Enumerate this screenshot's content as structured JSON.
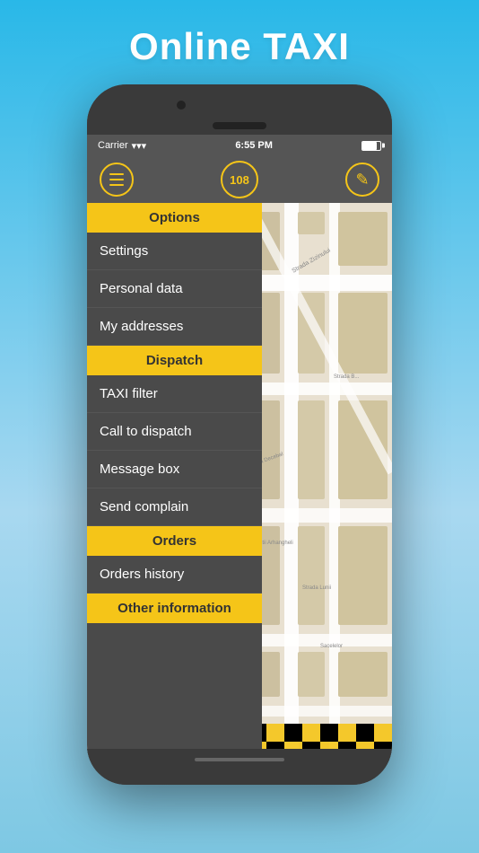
{
  "page": {
    "title": "Online TAXI",
    "background_color_top": "#29b8e8",
    "background_color_bottom": "#7ec8e3"
  },
  "status_bar": {
    "carrier": "Carrier",
    "wifi_symbol": "▾",
    "time": "6:55 PM",
    "battery_label": "battery"
  },
  "header": {
    "menu_icon": "≡",
    "badge_value": "108",
    "edit_icon": "✎"
  },
  "menu": {
    "sections": [
      {
        "type": "header",
        "label": "Options",
        "color": "#f5c518"
      },
      {
        "type": "item",
        "label": "Settings"
      },
      {
        "type": "item",
        "label": "Personal data"
      },
      {
        "type": "item",
        "label": "My addresses"
      },
      {
        "type": "header",
        "label": "Dispatch",
        "color": "#f5c518"
      },
      {
        "type": "item",
        "label": "TAXI filter"
      },
      {
        "type": "item",
        "label": "Call to dispatch"
      },
      {
        "type": "item",
        "label": "Message box"
      },
      {
        "type": "item",
        "label": "Send complain"
      },
      {
        "type": "header",
        "label": "Orders",
        "color": "#f5c518"
      },
      {
        "type": "item",
        "label": "Orders history"
      },
      {
        "type": "header",
        "label": "Other information",
        "color": "#f5c518"
      }
    ]
  }
}
